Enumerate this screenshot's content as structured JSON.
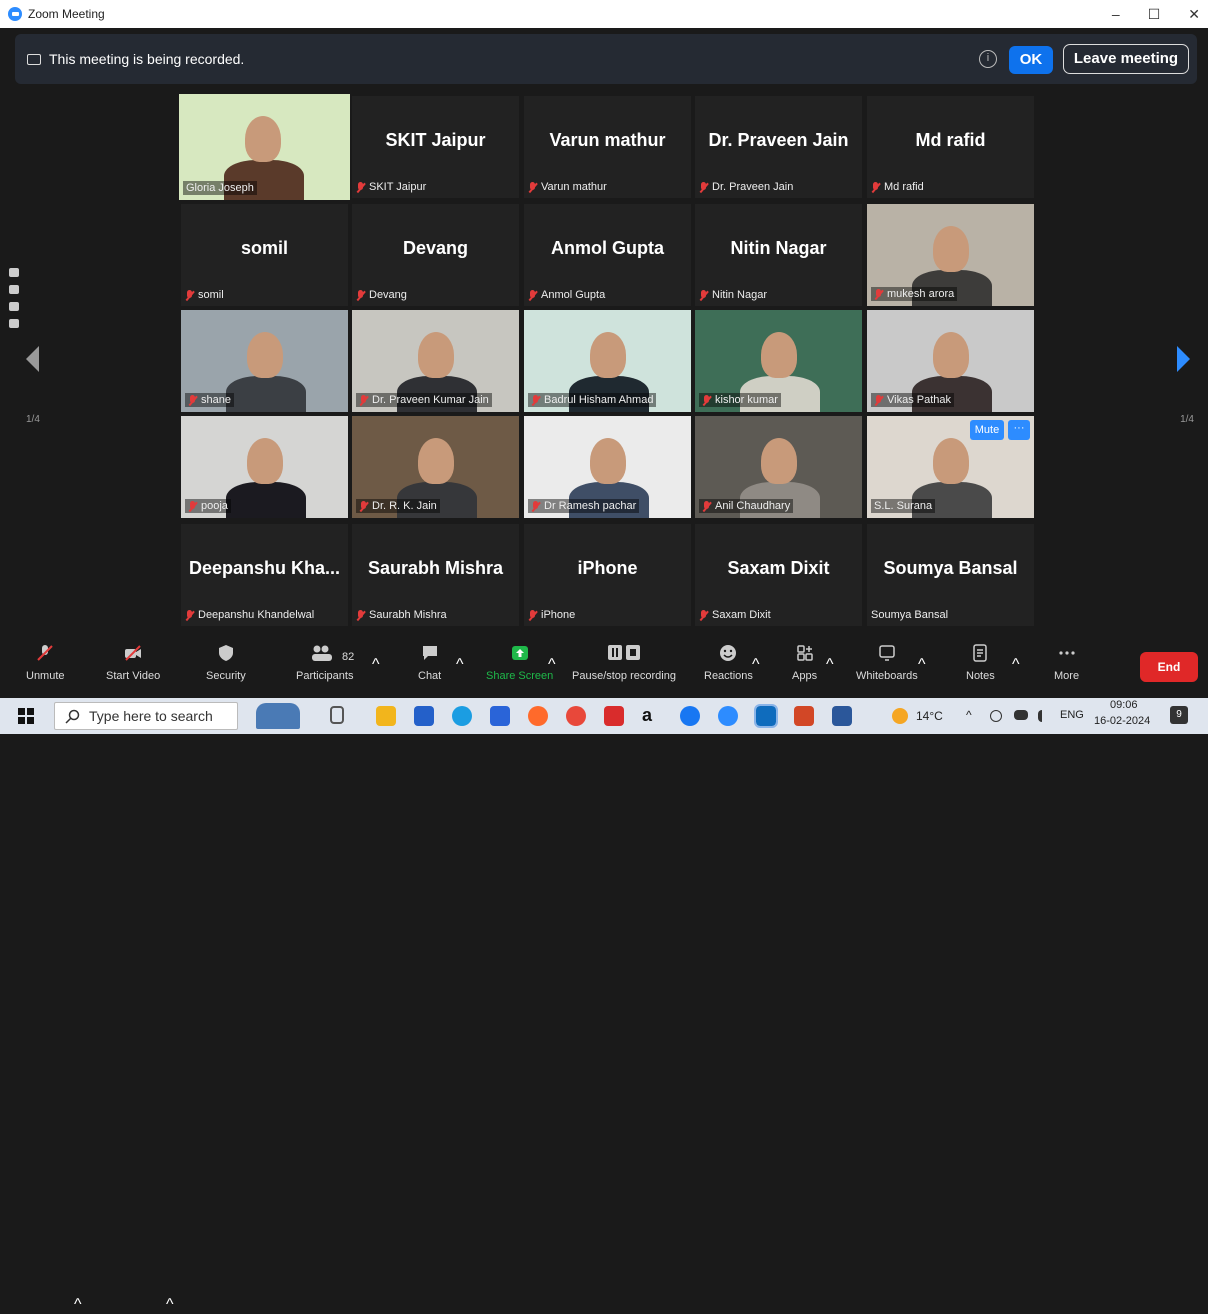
{
  "window": {
    "title": "Zoom Meeting",
    "controls": [
      "–",
      "☐",
      "✕"
    ]
  },
  "recording_banner": {
    "text": "This meeting is being recorded.",
    "ok_label": "OK",
    "leave_label": "Leave meeting",
    "info": "i"
  },
  "pager": {
    "left": "1/4",
    "right": "1/4"
  },
  "participants": [
    {
      "display": "",
      "tag": "Gloria Joseph",
      "video": true,
      "muted": false
    },
    {
      "display": "SKIT Jaipur",
      "tag": "SKIT Jaipur",
      "video": false,
      "muted": true
    },
    {
      "display": "Varun mathur",
      "tag": "Varun mathur",
      "video": false,
      "muted": true
    },
    {
      "display": "Dr. Praveen Jain",
      "tag": "Dr. Praveen Jain",
      "video": false,
      "muted": true
    },
    {
      "display": "Md rafid",
      "tag": "Md rafid",
      "video": false,
      "muted": true
    },
    {
      "display": "somil",
      "tag": "somil",
      "video": false,
      "muted": true
    },
    {
      "display": "Devang",
      "tag": "Devang",
      "video": false,
      "muted": true
    },
    {
      "display": "Anmol Gupta",
      "tag": "Anmol Gupta",
      "video": false,
      "muted": true
    },
    {
      "display": "Nitin Nagar",
      "tag": "Nitin Nagar",
      "video": false,
      "muted": true
    },
    {
      "display": "",
      "tag": "mukesh arora",
      "video": true,
      "muted": true
    },
    {
      "display": "",
      "tag": "shane",
      "video": true,
      "muted": true
    },
    {
      "display": "",
      "tag": "Dr. Praveen Kumar Jain",
      "video": true,
      "muted": true
    },
    {
      "display": "",
      "tag": "Badrul Hisham Ahmad",
      "video": true,
      "muted": true
    },
    {
      "display": "",
      "tag": "kishor kumar",
      "video": true,
      "muted": true
    },
    {
      "display": "",
      "tag": "Vikas Pathak",
      "video": true,
      "muted": true
    },
    {
      "display": "",
      "tag": "pooja",
      "video": true,
      "muted": true
    },
    {
      "display": "",
      "tag": "Dr. R. K. Jain",
      "video": true,
      "muted": true
    },
    {
      "display": "",
      "tag": "Dr Ramesh pachar",
      "video": true,
      "muted": true
    },
    {
      "display": "",
      "tag": "Anil Chaudhary",
      "video": true,
      "muted": true
    },
    {
      "display": "",
      "tag": "S.L. Surana",
      "video": true,
      "muted": false,
      "hover_mute": "Mute",
      "hover_more": "···"
    },
    {
      "display": "Deepanshu  Kha...",
      "tag": "Deepanshu Khandelwal",
      "video": false,
      "muted": true
    },
    {
      "display": "Saurabh Mishra",
      "tag": "Saurabh Mishra",
      "video": false,
      "muted": true
    },
    {
      "display": "iPhone",
      "tag": "iPhone",
      "video": false,
      "muted": true
    },
    {
      "display": "Saxam Dixit",
      "tag": "Saxam Dixit",
      "video": false,
      "muted": true
    },
    {
      "display": "Soumya Bansal",
      "tag": "Soumya Bansal",
      "video": false,
      "muted": false
    }
  ],
  "toolbar": {
    "unmute": "Unmute",
    "start_video": "Start Video",
    "security": "Security",
    "participants": "Participants",
    "participants_count": "82",
    "chat": "Chat",
    "share_screen": "Share Screen",
    "pause_recording": "Pause/stop recording",
    "reactions": "Reactions",
    "apps": "Apps",
    "whiteboards": "Whiteboards",
    "notes": "Notes",
    "more": "More",
    "end": "End",
    "caret": "^"
  },
  "taskbar": {
    "search_placeholder": "Type here to search",
    "weather": "14°C",
    "lang": "ENG",
    "time": "09:06",
    "date": "16-02-2024",
    "notif": "9"
  },
  "colors": {
    "zoom_blue": "#2d8cff",
    "end_red": "#e02828",
    "active_share": "#1fb94a",
    "highlight": "#e9e86b"
  }
}
